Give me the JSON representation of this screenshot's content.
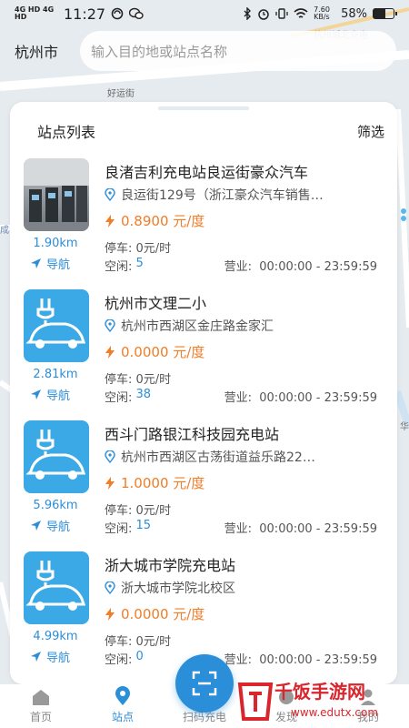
{
  "status_bar": {
    "network": "4G HD 4G HD",
    "time": "11:27",
    "speed": "7.60 KB/s",
    "battery_percent": "58%",
    "battery_level": 0.58
  },
  "header": {
    "city": "杭州市",
    "search_placeholder": "输入目的地或站点名称"
  },
  "map_labels": {
    "road1": "好运街",
    "road2": "杭州城北充电",
    "road3": "成",
    "road4": "华"
  },
  "sheet": {
    "title": "站点列表",
    "filter_label": "筛选"
  },
  "labels": {
    "parking": "停车:",
    "free": "空闲:",
    "business": "营业:",
    "navigate": "导航"
  },
  "stations": [
    {
      "name": "良渚吉利充电站良运街豪众汽车",
      "address": "良运街129号（浙江豪众汽车销售…",
      "price": "0.8900 元/度",
      "distance": "1.90km",
      "parking": "0元/时",
      "free": "5",
      "hours": "00:00:00 - 23:59:59",
      "thumb": "photo"
    },
    {
      "name": "杭州市文理二小",
      "address": "杭州市西湖区金庄路金家汇",
      "price": "0.0000 元/度",
      "distance": "2.81km",
      "parking": "0元/时",
      "free": "38",
      "hours": "00:00:00 - 23:59:59",
      "thumb": "ev"
    },
    {
      "name": "西斗门路银江科技园充电站",
      "address": "杭州市西湖区古荡街道益乐路22…",
      "price": "1.0000 元/度",
      "distance": "5.96km",
      "parking": "0元/时",
      "free": "15",
      "hours": "00:00:00 - 23:59:59",
      "thumb": "ev"
    },
    {
      "name": "浙大城市学院充电站",
      "address": "浙大城市学院北校区",
      "price": "0.0000 元/度",
      "distance": "4.99km",
      "parking": "0元/时",
      "free": "0",
      "hours": "00:00:00 - 23:59:59",
      "thumb": "ev"
    }
  ],
  "bottom_nav": {
    "home": "首页",
    "stations": "站点",
    "scan": "扫码充电",
    "discover": "发现",
    "mine": "我的"
  },
  "watermark": {
    "title": "千饭手游网",
    "url": "www.edutx.com"
  },
  "colors": {
    "accent": "#2b8ed9",
    "price": "#f07d28",
    "ev_thumb": "#3aa9e6"
  }
}
